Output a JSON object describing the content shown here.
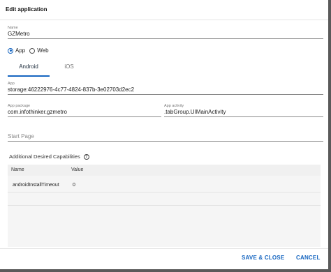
{
  "dialog": {
    "title": "Edit application"
  },
  "name_field": {
    "label": "Name",
    "value": "GZMetro"
  },
  "platform": {
    "options": [
      "App",
      "Web"
    ],
    "selected": "App"
  },
  "tabs": [
    {
      "label": "Android",
      "active": true
    },
    {
      "label": "iOS",
      "active": false
    }
  ],
  "app_field": {
    "label": "App",
    "value": "storage:46222976-4c77-4824-837b-3e02703d2ec2"
  },
  "package_field": {
    "label": "App package",
    "value": "com.infothinker.gzmetro"
  },
  "activity_field": {
    "label": "App activity",
    "value": ".tabGroup.UIMainActivity"
  },
  "start_page_field": {
    "placeholder": "Start Page"
  },
  "capabilities": {
    "heading": "Additional Desired Capabilities",
    "help_icon": "?",
    "columns": [
      "Name",
      "Value"
    ],
    "rows": [
      {
        "name": "androidInstallTimeout",
        "value": "0"
      }
    ]
  },
  "footer": {
    "save_label": "SAVE & CLOSE",
    "cancel_label": "CANCEL"
  },
  "colors": {
    "accent": "#1565c0",
    "backdrop": "#5a5a5a"
  }
}
